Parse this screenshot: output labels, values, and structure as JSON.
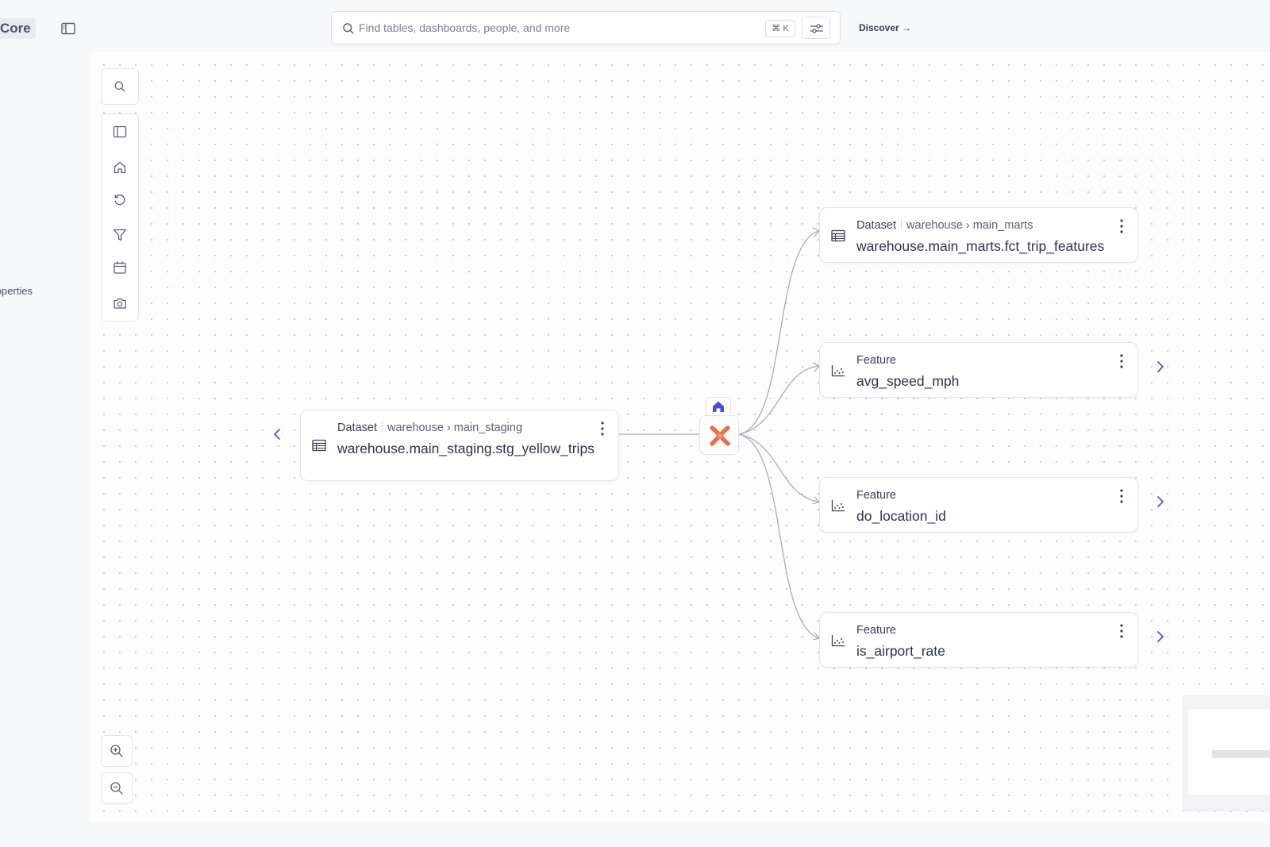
{
  "header": {
    "brand": "Core",
    "search": {
      "placeholder": "Find tables, dashboards, people, and more",
      "value": "",
      "shortcut": "⌘ K"
    },
    "discover_label": "Discover →"
  },
  "left_panel": {
    "partial_label": "Properties"
  },
  "toolbar": {
    "items": [
      {
        "icon": "search-icon"
      },
      {
        "icon": "sidebar-icon"
      },
      {
        "icon": "home-icon"
      },
      {
        "icon": "reset-icon"
      },
      {
        "icon": "filter-icon"
      },
      {
        "icon": "calendar-icon"
      },
      {
        "icon": "camera-icon"
      }
    ]
  },
  "lineage": {
    "source": {
      "type": "Dataset",
      "platform": "warehouse",
      "schema": "main_staging",
      "name": "warehouse.main_staging.stg_yellow_trips"
    },
    "job": {
      "icon": "dagster-icon",
      "badge_icon": "home-icon"
    },
    "targets": [
      {
        "type": "Dataset",
        "platform": "warehouse",
        "schema": "main_marts",
        "name": "warehouse.main_marts.fct_trip_features",
        "expandable": false
      },
      {
        "type": "Feature",
        "name": "avg_speed_mph",
        "expandable": true
      },
      {
        "type": "Feature",
        "name": "do_location_id",
        "expandable": true
      },
      {
        "type": "Feature",
        "name": "is_airport_rate",
        "expandable": true
      }
    ]
  },
  "colors": {
    "accent": "#4a4fd1",
    "job_orange": "#f26b4b",
    "edge": "#a9adb6"
  }
}
